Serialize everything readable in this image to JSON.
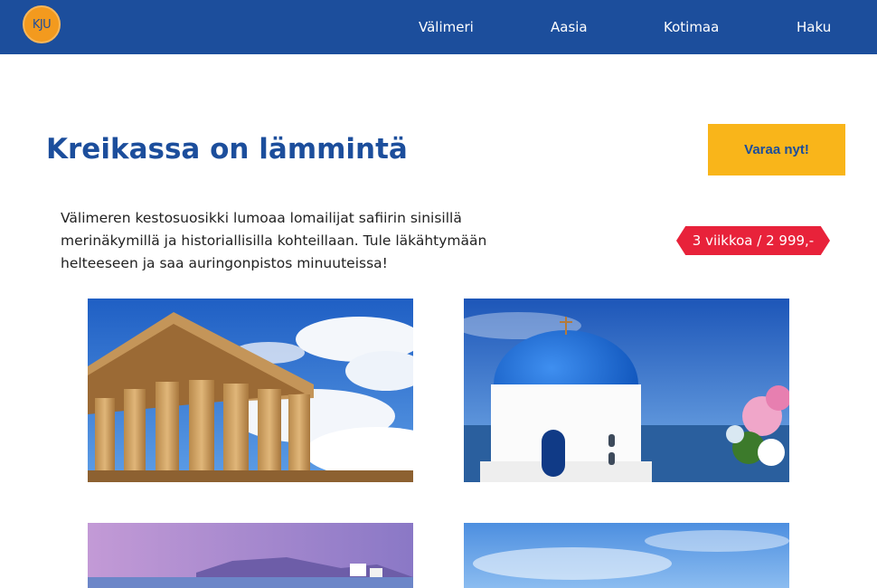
{
  "brand": {
    "logo_text": "KJU",
    "colors": {
      "primary": "#1c4e9c",
      "accent": "#f9b51a",
      "badge": "#e8223a"
    }
  },
  "nav": {
    "items": [
      {
        "label": "Välimeri"
      },
      {
        "label": "Aasia"
      },
      {
        "label": "Kotimaa"
      },
      {
        "label": "Haku"
      }
    ]
  },
  "main": {
    "title": "Kreikassa on lämmintä",
    "book_button": "Varaa nyt!",
    "intro": "Välimeren kestosuosikki lumoaa lomailijat safiirin sinisillä merinäkymillä ja historiallisilla kohteillaan. Tule läkähtymään helteeseen ja saa auringonpistos minuuteissa!",
    "price": "3 viikkoa / 2 999,-"
  },
  "gallery": [
    {
      "icon": "parthenon-photo"
    },
    {
      "icon": "blue-dome-church-photo"
    },
    {
      "icon": "santorini-sunset-photo"
    },
    {
      "icon": "sky-photo"
    }
  ]
}
